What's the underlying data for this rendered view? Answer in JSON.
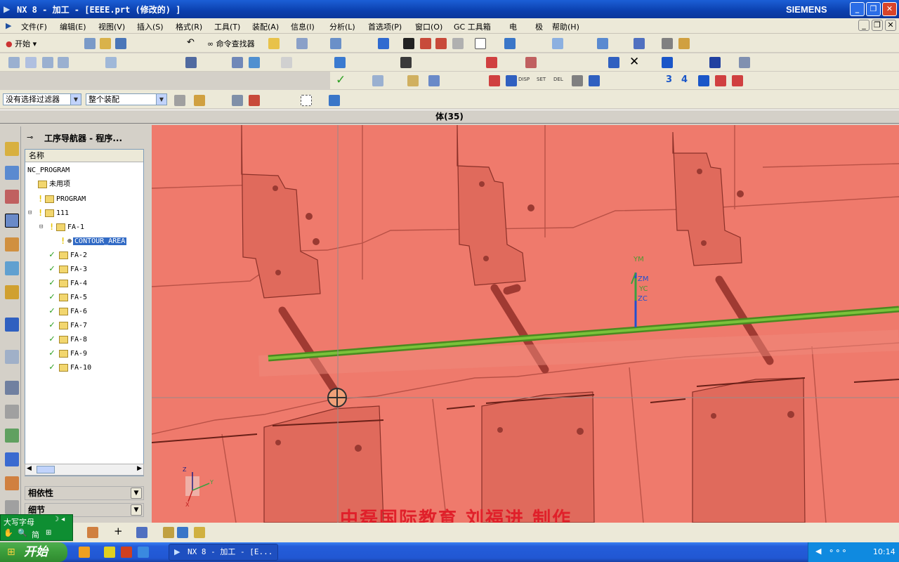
{
  "window": {
    "title": "NX 8 - 加工 - [EEEE.prt (修改的) ]",
    "brand": "SIEMENS",
    "btn_min": "_",
    "btn_restore": "❐",
    "btn_close": "✕"
  },
  "menu": [
    "文件(F)",
    "编辑(E)",
    "视图(V)",
    "插入(S)",
    "格式(R)",
    "工具(T)",
    "装配(A)",
    "信息(I)",
    "分析(L)",
    "首选项(P)",
    "窗口(O)",
    "GC 工具箱",
    "电",
    "极",
    "帮助(H)"
  ],
  "menu_right": {
    "min": "_",
    "restore": "❐",
    "close": "✕"
  },
  "toolbar": {
    "start_label": "开始",
    "command_finder": "命令查找器"
  },
  "filter": {
    "selection_filter": "没有选择过滤器",
    "assembly_scope": "整个装配"
  },
  "status": {
    "text": "体(35)"
  },
  "navigator": {
    "title": "工序导航器 - 程序...",
    "column": "名称",
    "items": [
      {
        "label": "NC_PROGRAM",
        "level": 0,
        "status": "none"
      },
      {
        "label": "未用项",
        "level": 1,
        "status": "none"
      },
      {
        "label": "PROGRAM",
        "level": 1,
        "status": "bulb"
      },
      {
        "label": "111",
        "level": 1,
        "status": "bulb",
        "expanded": true
      },
      {
        "label": "FA-1",
        "level": 2,
        "status": "bulb",
        "expanded": true
      },
      {
        "label": "CONTOUR_AREA",
        "level": 3,
        "status": "bulb",
        "selected": true
      },
      {
        "label": "FA-2",
        "level": 2,
        "status": "check"
      },
      {
        "label": "FA-3",
        "level": 2,
        "status": "check"
      },
      {
        "label": "FA-4",
        "level": 2,
        "status": "check"
      },
      {
        "label": "FA-5",
        "level": 2,
        "status": "check"
      },
      {
        "label": "FA-6",
        "level": 2,
        "status": "check"
      },
      {
        "label": "FA-7",
        "level": 2,
        "status": "check"
      },
      {
        "label": "FA-8",
        "level": 2,
        "status": "check"
      },
      {
        "label": "FA-9",
        "level": 2,
        "status": "check"
      },
      {
        "label": "FA-10",
        "level": 2,
        "status": "check"
      }
    ],
    "sections": {
      "dependencies": "相依性",
      "details": "细节"
    }
  },
  "viewport": {
    "wcs_labels": [
      "YM",
      "ZM",
      "YC",
      "ZC"
    ],
    "triad_labels": [
      "Z",
      "Y",
      "X"
    ],
    "body_color": "#ef7a6c",
    "rail_color": "#5aa82a"
  },
  "watermark": "中磊国际教育   刘福进   制作",
  "ime": {
    "line1": "大写字母",
    "line2": "简"
  },
  "taskbar": {
    "start": "开始",
    "task": "NX 8 - 加工 - [E...",
    "clock": "10:14"
  },
  "colors": {
    "title_blue": "#0b3fae",
    "selection": "#316ac5",
    "check_green": "#2da022"
  }
}
